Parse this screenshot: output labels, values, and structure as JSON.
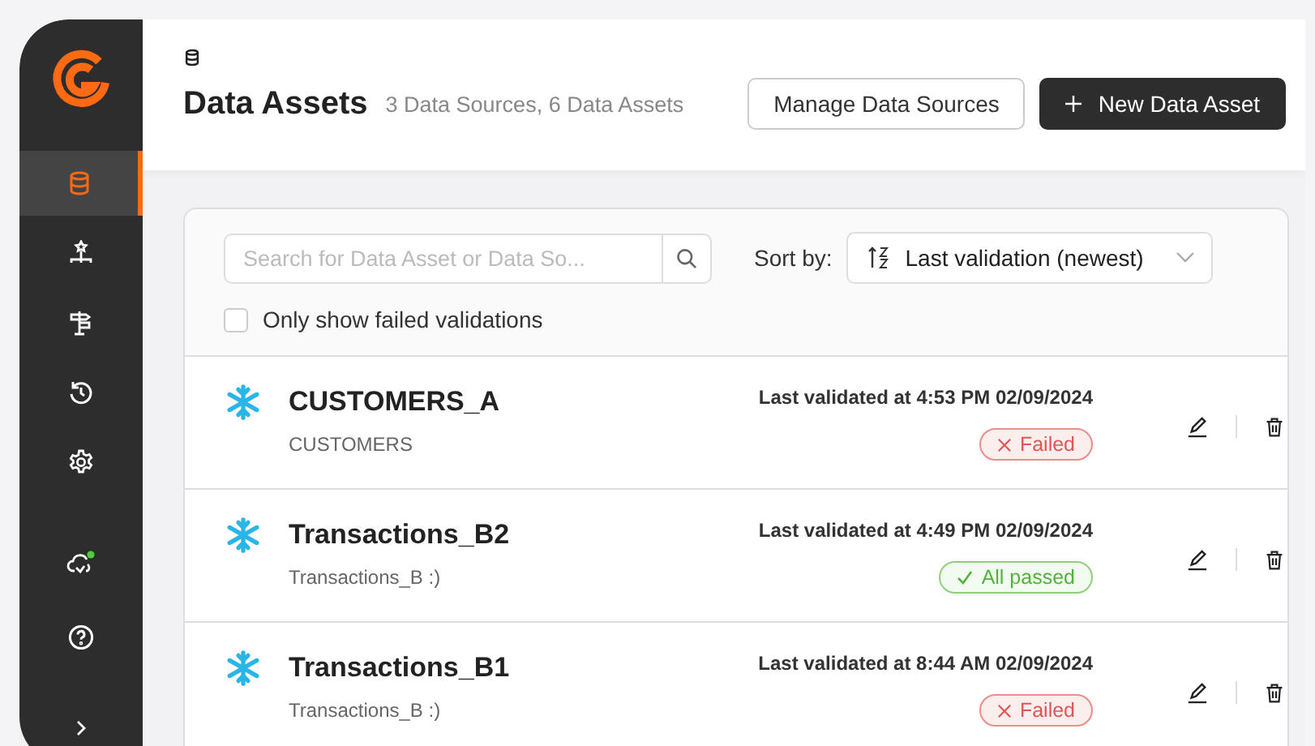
{
  "sidebar": {
    "items": [
      {
        "kind": "database",
        "selected": true
      },
      {
        "kind": "hierarchy",
        "selected": false
      },
      {
        "kind": "signpost",
        "selected": false
      },
      {
        "kind": "history",
        "selected": false
      },
      {
        "kind": "settings",
        "selected": false
      },
      {
        "kind": "cloud",
        "selected": false
      },
      {
        "kind": "help",
        "selected": false
      }
    ]
  },
  "header": {
    "title": "Data Assets",
    "subtitle": "3 Data Sources, 6 Data Assets",
    "buttons": [
      {
        "label": "Manage Data Sources",
        "kind": "secondary"
      },
      {
        "label": "New Data Asset",
        "kind": "primary"
      }
    ]
  },
  "filters": {
    "search": {
      "placeholder": "Search for Data Asset or Data So..."
    },
    "sort_label": "Sort by:",
    "sort_value": "Last validation (newest)",
    "checkbox": {
      "label": "Only show failed validations",
      "checked": false
    }
  },
  "assets": [
    {
      "name": "CUSTOMERS_A",
      "source": "CUSTOMERS",
      "validated": "Last validated at 4:53 PM 02/09/2024",
      "status": {
        "kind": "failed",
        "label": "Failed"
      }
    },
    {
      "name": "Transactions_B2",
      "source": "Transactions_B :)",
      "validated": "Last validated at 4:49 PM 02/09/2024",
      "status": {
        "kind": "passed",
        "label": "All passed"
      }
    },
    {
      "name": "Transactions_B1",
      "source": "Transactions_B :)",
      "validated": "Last validated at 8:44 AM 02/09/2024",
      "status": {
        "kind": "failed",
        "label": "Failed"
      }
    }
  ]
}
